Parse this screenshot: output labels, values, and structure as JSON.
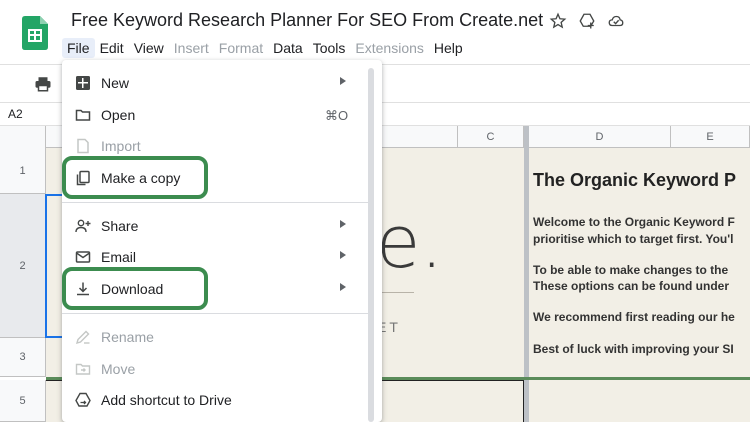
{
  "app": {
    "title": "Free Keyword Research Planner For SEO From Create.net",
    "menu": [
      {
        "label": "File",
        "state": "active"
      },
      {
        "label": "Edit",
        "state": "normal"
      },
      {
        "label": "View",
        "state": "normal"
      },
      {
        "label": "Insert",
        "state": "disabled"
      },
      {
        "label": "Format",
        "state": "disabled"
      },
      {
        "label": "Data",
        "state": "normal"
      },
      {
        "label": "Tools",
        "state": "normal"
      },
      {
        "label": "Extensions",
        "state": "disabled"
      },
      {
        "label": "Help",
        "state": "normal"
      }
    ],
    "icons": [
      "star-icon",
      "add-to-drive-icon",
      "cloud-status-icon",
      "print-icon"
    ]
  },
  "formula_bar": {
    "cell_ref": "A2"
  },
  "grid": {
    "columns": [
      "C",
      "D",
      "E"
    ],
    "rows": [
      "1",
      "2",
      "3",
      "5"
    ],
    "brand_mark": "e.",
    "brand_tag": "ET",
    "sheet_title": "The Organic Keyword P",
    "sheet_lines": [
      "Welcome to the Organic Keyword F",
      "prioritise which to target first. You'l",
      "To be able to make changes to the",
      "These options can be found under",
      "We recommend first reading our he",
      "Best of luck with improving your SI"
    ]
  },
  "file_menu": {
    "items": [
      {
        "label": "New",
        "icon": "new-sheet-icon",
        "enabled": true,
        "submenu": true,
        "shortcut": ""
      },
      {
        "label": "Open",
        "icon": "folder-icon",
        "enabled": true,
        "submenu": false,
        "shortcut": "⌘O"
      },
      {
        "label": "Import",
        "icon": "import-file-icon",
        "enabled": false,
        "submenu": false,
        "shortcut": ""
      },
      {
        "label": "Make a copy",
        "icon": "copy-icon",
        "enabled": true,
        "submenu": false,
        "shortcut": "",
        "highlighted": true
      },
      {
        "label": "Share",
        "icon": "share-person-icon",
        "enabled": true,
        "submenu": true,
        "shortcut": ""
      },
      {
        "label": "Email",
        "icon": "email-icon",
        "enabled": true,
        "submenu": true,
        "shortcut": ""
      },
      {
        "label": "Download",
        "icon": "download-icon",
        "enabled": true,
        "submenu": true,
        "shortcut": "",
        "highlighted": true
      },
      {
        "label": "Rename",
        "icon": "rename-icon",
        "enabled": false,
        "submenu": false,
        "shortcut": ""
      },
      {
        "label": "Move",
        "icon": "move-icon",
        "enabled": false,
        "submenu": false,
        "shortcut": ""
      },
      {
        "label": "Add shortcut to Drive",
        "icon": "drive-shortcut-icon",
        "enabled": true,
        "submenu": false,
        "shortcut": ""
      }
    ],
    "highlight_color": "#3c8c4f"
  },
  "colors": {
    "logo_green": "#23a566",
    "cell_background": "#f2efe6",
    "selection_blue": "#1a73e8",
    "active_menu_bg": "#e8eef9",
    "divider_green": "#5b8c5a"
  }
}
